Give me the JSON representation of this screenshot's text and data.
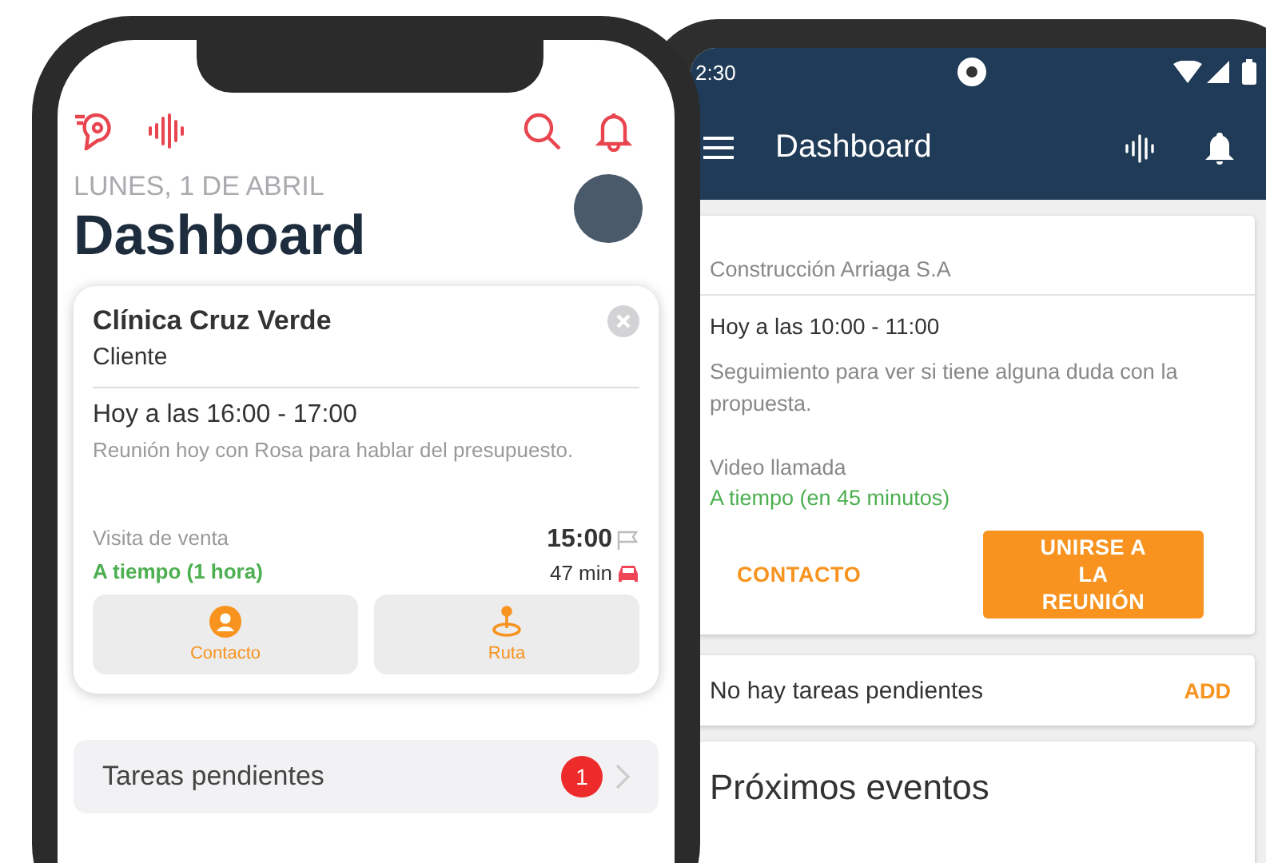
{
  "iphone": {
    "date": "LUNES, 1 DE ABRIL",
    "title": "Dashboard",
    "event_card": {
      "title": "Clínica Cruz Verde",
      "subtitle": "Cliente",
      "time": "Hoy a las 16:00 - 17:00",
      "description": "Reunión hoy con Rosa para hablar del presupuesto.",
      "type": "Visita de venta",
      "status": "A tiempo (1 hora)",
      "start_time": "15:00",
      "travel_time": "47 min",
      "actions": [
        {
          "label": "Contacto",
          "kind": "contact"
        },
        {
          "label": "Ruta",
          "kind": "route"
        }
      ]
    },
    "tasks_row": {
      "label": "Tareas pendientes",
      "badge": "1"
    }
  },
  "android": {
    "status_bar": {
      "time": "2:30"
    },
    "toolbar": {
      "title": "Dashboard"
    },
    "event_card": {
      "company": "Construcción Arriaga S.A",
      "time": "Hoy a las 10:00 - 11:00",
      "description": "Seguimiento para ver si tiene alguna duda con la propuesta.",
      "type": "Video llamada",
      "status": "A tiempo (en 45 minutos)",
      "actions": [
        {
          "label": "CONTACTO",
          "kind": "text"
        },
        {
          "label": "UNIRSE A LA REUNIÓN",
          "kind": "filled"
        }
      ]
    },
    "tasks_card": {
      "label": "No hay tareas pendientes",
      "action": "ADD"
    },
    "upcoming": {
      "title": "Próximos eventos"
    }
  }
}
